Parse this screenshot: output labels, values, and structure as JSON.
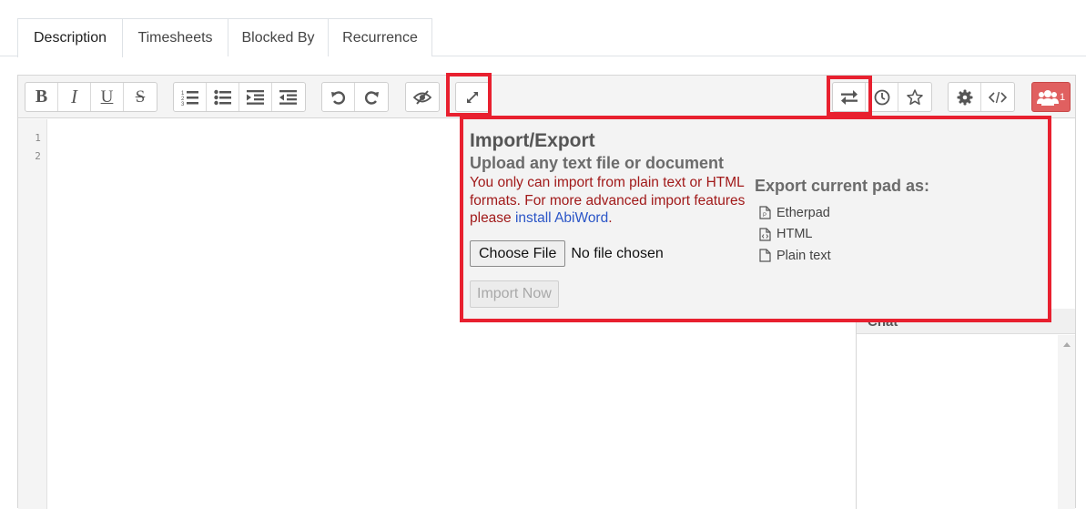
{
  "tabs": [
    {
      "label": "Description",
      "active": true
    },
    {
      "label": "Timesheets",
      "active": false
    },
    {
      "label": "Blocked By",
      "active": false
    },
    {
      "label": "Recurrence",
      "active": false
    }
  ],
  "toolbar": {
    "format_buttons": [
      {
        "icon": "bold-icon",
        "glyph": "B"
      },
      {
        "icon": "italic-icon",
        "glyph": "I"
      },
      {
        "icon": "underline-icon",
        "glyph": "U"
      },
      {
        "icon": "strikethrough-icon",
        "glyph": "S"
      }
    ],
    "list_buttons": [
      "ordered-list-icon",
      "unordered-list-icon",
      "indent-icon",
      "outdent-icon"
    ],
    "history_buttons": [
      "undo-icon",
      "redo-icon"
    ],
    "right_buttons": [
      "import-export-icon",
      "timeslider-icon",
      "star-icon",
      "settings-icon",
      "embed-icon"
    ],
    "user_count": "1"
  },
  "editor": {
    "line_numbers": [
      "1",
      "2"
    ]
  },
  "chat": {
    "title": "Chat"
  },
  "import_export": {
    "title": "Import/Export",
    "subtitle": "Upload any text file or document",
    "warning_text": "You only can import from plain text or HTML formats. For more advanced import features please ",
    "warning_link": "install AbiWord",
    "warning_end": ".",
    "choose_file_label": "Choose File",
    "no_file_text": "No file chosen",
    "import_now_label": "Import Now",
    "export_heading": "Export current pad as:",
    "export_options": [
      "Etherpad",
      "HTML",
      "Plain text"
    ]
  },
  "colors": {
    "highlight": "#e8202f",
    "users_button": "#e06060",
    "warning": "#a11a1a",
    "link": "#2a55c7"
  }
}
